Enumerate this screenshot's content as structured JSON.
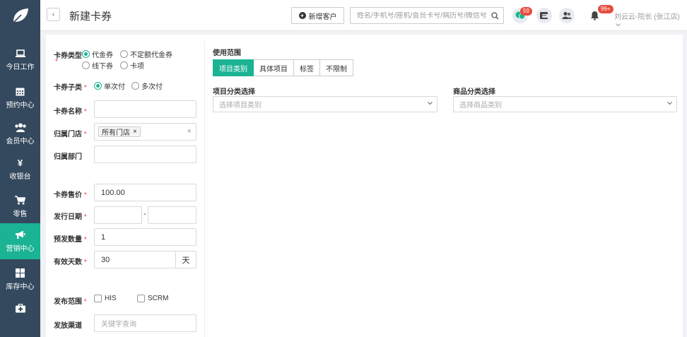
{
  "nav": {
    "items": [
      {
        "label": "今日工作",
        "icon": "laptop-icon"
      },
      {
        "label": "预约中心",
        "icon": "calendar-icon"
      },
      {
        "label": "会员中心",
        "icon": "users-icon"
      },
      {
        "label": "收银台",
        "icon": "yen-icon"
      },
      {
        "label": "零售",
        "icon": "cart-icon"
      },
      {
        "label": "营销中心",
        "icon": "megaphone-icon",
        "active": true
      },
      {
        "label": "库存中心",
        "icon": "grid-icon"
      },
      {
        "label": "",
        "icon": "medkit-icon"
      }
    ]
  },
  "header": {
    "title": "新建卡券",
    "add_customer": "新增客户",
    "search_placeholder": "姓名/手机号/座机/会员卡号/病历号/微信号",
    "chat_badge": "59",
    "bell_badge": "99+",
    "user": "刘云云-院长 (张江店)"
  },
  "form": {
    "card_type_label": "卡券类型",
    "card_type_options": [
      "代金券",
      "不定额代金券",
      "线下券",
      "卡项"
    ],
    "card_sub_label": "卡券子类",
    "card_sub_options": [
      "单次付",
      "多次付"
    ],
    "name_label": "卡券名称",
    "store_label": "归属门店",
    "store_tag": "所有门店",
    "dept_label": "归属部门",
    "price_label": "卡券售价",
    "price_value": "100.00",
    "date_label": "发行日期",
    "date_sep": "-",
    "qty_label": "预发数量",
    "qty_value": "1",
    "days_label": "有效天数",
    "days_value": "30",
    "days_unit": "天",
    "publish_label": "发布范围",
    "publish_options": [
      "HIS",
      "SCRM"
    ],
    "channel_label": "发放渠道",
    "channel_placeholder": "关键字查询",
    "required_mark": "*"
  },
  "scope": {
    "title": "使用范围",
    "tabs": [
      "项目类别",
      "具体项目",
      "标签",
      "不限制"
    ],
    "project_label": "项目分类选择",
    "project_placeholder": "选择项目类别",
    "goods_label": "商品分类选择",
    "goods_placeholder": "选择商品类别"
  },
  "colors": {
    "sidebar": "#34495e",
    "accent": "#1ab394",
    "badge": "#e74c3c"
  }
}
